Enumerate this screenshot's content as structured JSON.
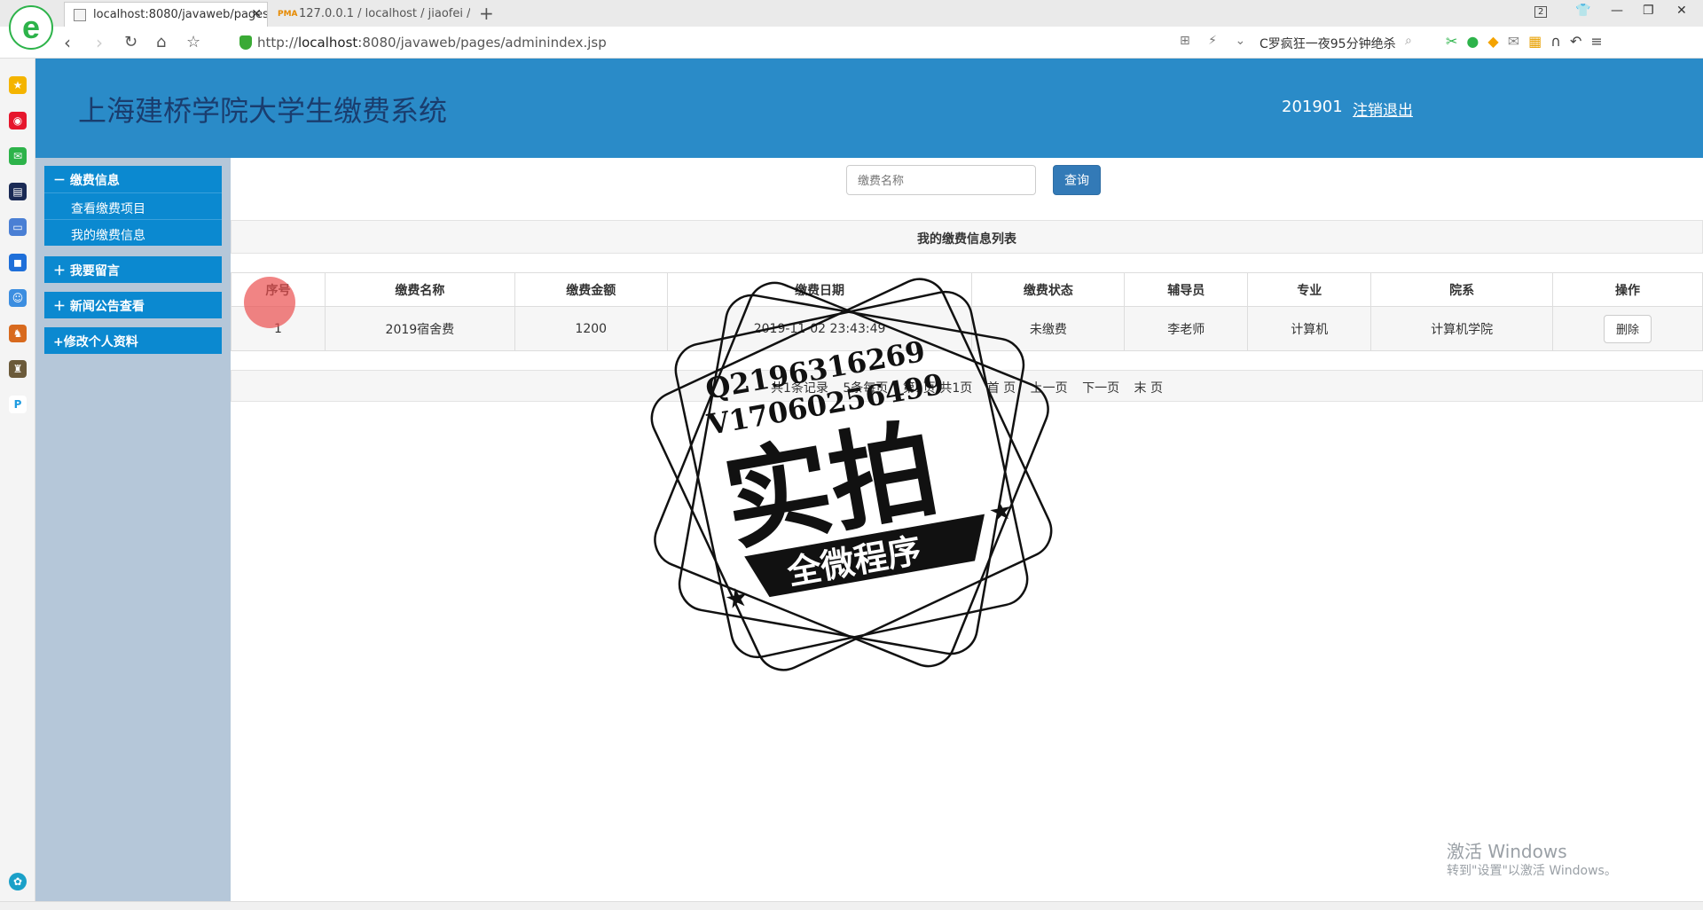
{
  "browser": {
    "tabs": [
      {
        "label": "localhost:8080/javaweb/pages/",
        "active": true
      },
      {
        "label": "127.0.0.1 / localhost / jiaofei /",
        "active": false
      }
    ],
    "tab_badge": "2",
    "url_prefix": "http://",
    "url_host": "localhost",
    "url_rest": ":8080/javaweb/pages/adminindex.jsp",
    "search_hint": "C罗疯狂一夜95分钟绝杀",
    "pma_label": "PMA",
    "logo_letter": "e",
    "sidebar_icons": [
      "star-icon",
      "weibo-icon",
      "mail-icon",
      "news-icon",
      "doc-icon",
      "chat-icon",
      "game1-icon",
      "game2-icon",
      "game3-icon",
      "p-icon"
    ]
  },
  "header": {
    "title": "上海建桥学院大学生缴费系统",
    "user_id": "201901",
    "logout_label": "注销退出"
  },
  "menu": {
    "group1": "－ 缴费信息",
    "group1_items": [
      "查看缴费项目",
      "我的缴费信息"
    ],
    "group2": "＋ 我要留言",
    "group3": "＋ 新闻公告查看",
    "group4": "+修改个人资料"
  },
  "search": {
    "placeholder": "缴费名称",
    "button_label": "查询"
  },
  "list": {
    "title": "我的缴费信息列表",
    "columns": [
      "序号",
      "缴费名称",
      "缴费金额",
      "缴费日期",
      "缴费状态",
      "辅导员",
      "专业",
      "院系",
      "操作"
    ],
    "rows": [
      {
        "index": "1",
        "name": "2019宿舍费",
        "amount": "1200",
        "date": "2019-11-02 23:43:49",
        "status": "未缴费",
        "counselor": "李老师",
        "major": "计算机",
        "department": "计算机学院",
        "action": "删除"
      }
    ]
  },
  "pager": {
    "total": "共1条记录",
    "per_page": "5条每页",
    "page_info": "第1页/共1页",
    "first": "首 页",
    "prev": "上一页",
    "next": "下一页",
    "last": "末 页"
  },
  "watermark": {
    "line1": "Q2196316269",
    "line2": "V17060256499",
    "big": "实拍",
    "banner": "全微程序"
  },
  "os": {
    "activate_title": "激活 Windows",
    "activate_sub": "转到\"设置\"以激活 Windows。"
  },
  "colors": {
    "header_bg": "#2a8bc8",
    "menu_bg": "#0b89d0",
    "menu_panel": "#b5c7d9",
    "primary_button": "#337ab7"
  }
}
